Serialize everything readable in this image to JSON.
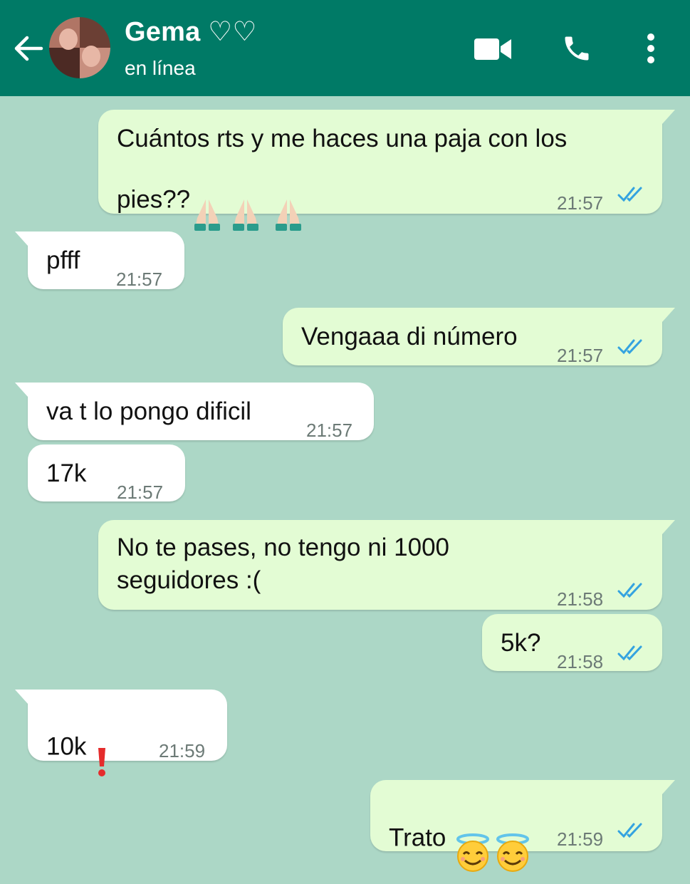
{
  "header": {
    "contact_name": "Gema ♡♡",
    "status": "en línea",
    "icons": [
      "back-arrow-icon",
      "video-call-icon",
      "phone-icon",
      "more-options-icon"
    ],
    "bg_color": "#007a66"
  },
  "chat": {
    "background": "#acd7c6",
    "outgoing_color": "#e3fcd4",
    "incoming_color": "#ffffff",
    "read_tick_color": "#34a3e0",
    "messages": [
      {
        "dir": "out",
        "text": "Cuántos rts y me haces una paja con los\npies??",
        "emoji": [
          "folded-hands",
          "folded-hands",
          "folded-hands"
        ],
        "time": "21:57",
        "read": true
      },
      {
        "dir": "in",
        "text": "pfff",
        "time": "21:57"
      },
      {
        "dir": "out",
        "text": "Vengaaa di número",
        "time": "21:57",
        "read": true
      },
      {
        "dir": "in",
        "text": "va t lo pongo dificil",
        "time": "21:57"
      },
      {
        "dir": "in",
        "text": "17k",
        "time": "21:57"
      },
      {
        "dir": "out",
        "text": "No te pases, no tengo ni 1000\nseguidores :(",
        "time": "21:58",
        "read": true
      },
      {
        "dir": "out",
        "text": "5k?",
        "time": "21:58",
        "read": true
      },
      {
        "dir": "in",
        "text": "10k",
        "emoji": [
          "exclamation-mark"
        ],
        "time": "21:59"
      },
      {
        "dir": "out",
        "text": "Trato",
        "emoji": [
          "smiling-face-with-halo",
          "smiling-face-with-halo"
        ],
        "time": "21:59",
        "read": true
      }
    ]
  }
}
